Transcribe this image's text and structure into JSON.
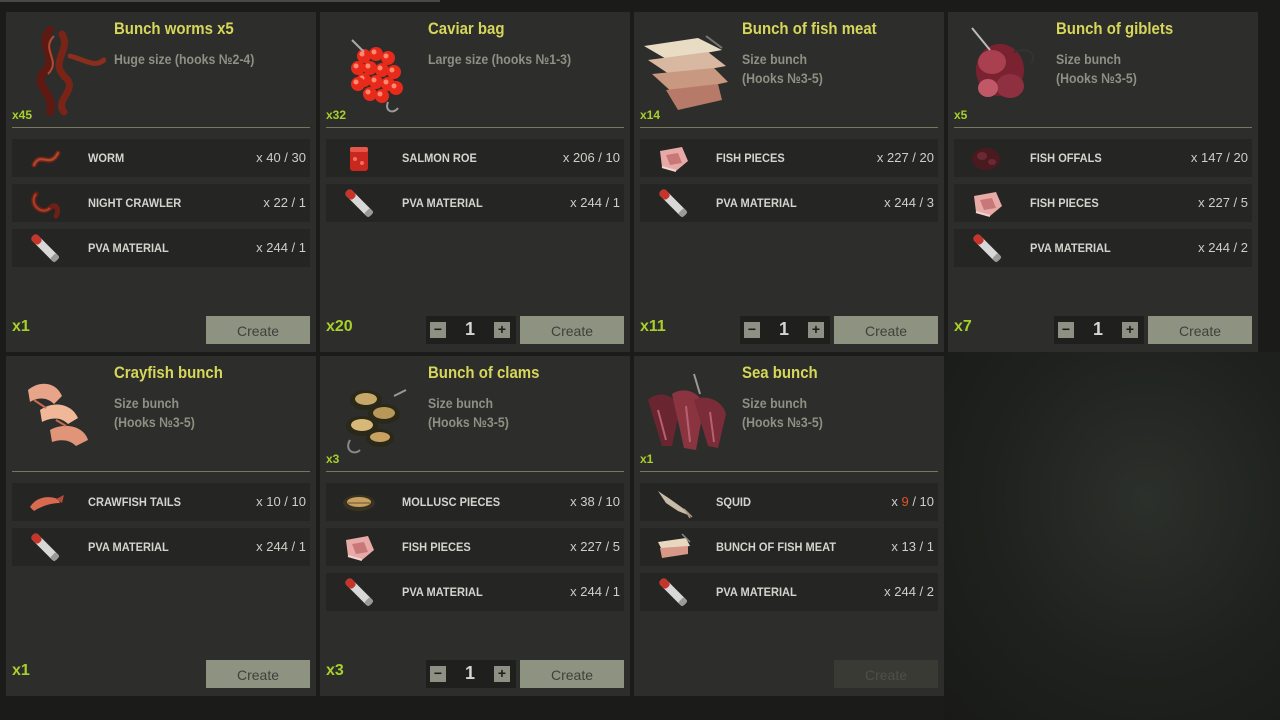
{
  "recipes": [
    {
      "title": "Bunch worms x5",
      "subtitle": "Huge size (hooks №2-4)",
      "stock": "x45",
      "multiplier": "x1",
      "stepper": null,
      "create_label": "Create",
      "create_enabled": true,
      "thumb_icon": "worm-bunch-icon",
      "ingredients": [
        {
          "icon": "worm-icon",
          "name": "WORM",
          "count": "x 40 / 30"
        },
        {
          "icon": "night-crawler-icon",
          "name": "NIGHT CRAWLER",
          "count": "x 22 / 1"
        },
        {
          "icon": "pva-material-icon",
          "name": "PVA MATERIAL",
          "count": "x 244 / 1"
        }
      ]
    },
    {
      "title": "Caviar bag",
      "subtitle": "Large size (hooks №1-3)",
      "stock": "x32",
      "multiplier": "x20",
      "stepper": "1",
      "create_label": "Create",
      "create_enabled": true,
      "thumb_icon": "caviar-bag-icon",
      "ingredients": [
        {
          "icon": "salmon-roe-icon",
          "name": "SALMON ROE",
          "count": "x 206 / 10"
        },
        {
          "icon": "pva-material-icon",
          "name": "PVA MATERIAL",
          "count": "x 244 / 1"
        }
      ]
    },
    {
      "title": "Bunch of fish meat",
      "subtitle": "Size bunch\n(Hooks №3-5)",
      "stock": "x14",
      "multiplier": "x11",
      "stepper": "1",
      "create_label": "Create",
      "create_enabled": true,
      "thumb_icon": "fish-meat-bunch-icon",
      "ingredients": [
        {
          "icon": "fish-pieces-icon",
          "name": "FISH PIECES",
          "count": "x 227 / 20"
        },
        {
          "icon": "pva-material-icon",
          "name": "PVA MATERIAL",
          "count": "x 244 / 3"
        }
      ]
    },
    {
      "title": "Bunch of giblets",
      "subtitle": "Size bunch\n(Hooks №3-5)",
      "stock": "x5",
      "multiplier": "x7",
      "stepper": "1",
      "create_label": "Create",
      "create_enabled": true,
      "thumb_icon": "giblets-bunch-icon",
      "ingredients": [
        {
          "icon": "fish-offals-icon",
          "name": "FISH OFFALS",
          "count": "x 147 / 20"
        },
        {
          "icon": "fish-pieces-icon",
          "name": "FISH PIECES",
          "count": "x 227 / 5"
        },
        {
          "icon": "pva-material-icon",
          "name": "PVA MATERIAL",
          "count": "x 244 / 2"
        }
      ]
    },
    {
      "title": "Crayfish bunch",
      "subtitle": "Size bunch\n(Hooks №3-5)",
      "stock": "",
      "multiplier": "x1",
      "stepper": null,
      "create_label": "Create",
      "create_enabled": true,
      "thumb_icon": "crayfish-bunch-icon",
      "ingredients": [
        {
          "icon": "crawfish-tails-icon",
          "name": "CRAWFISH TAILS",
          "count": "x 10 / 10"
        },
        {
          "icon": "pva-material-icon",
          "name": "PVA MATERIAL",
          "count": "x 244 / 1"
        }
      ]
    },
    {
      "title": "Bunch of clams",
      "subtitle": "Size bunch\n(Hooks №3-5)",
      "stock": "x3",
      "multiplier": "x3",
      "stepper": "1",
      "create_label": "Create",
      "create_enabled": true,
      "thumb_icon": "clams-bunch-icon",
      "ingredients": [
        {
          "icon": "mollusc-pieces-icon",
          "name": "MOLLUSC PIECES",
          "count": "x 38 / 10"
        },
        {
          "icon": "fish-pieces-icon",
          "name": "FISH PIECES",
          "count": "x 227 / 5"
        },
        {
          "icon": "pva-material-icon",
          "name": "PVA MATERIAL",
          "count": "x 244 / 1"
        }
      ]
    },
    {
      "title": "Sea bunch",
      "subtitle": "Size bunch\n(Hooks №3-5)",
      "stock": "x1",
      "multiplier": "",
      "stepper": null,
      "create_label": "Create",
      "create_enabled": false,
      "thumb_icon": "sea-bunch-icon",
      "ingredients": [
        {
          "icon": "squid-icon",
          "name": "SQUID",
          "count_prefix": "x ",
          "count_have": "9",
          "count_need": " / 10",
          "insufficient": true
        },
        {
          "icon": "bunch-of-fish-meat-icon",
          "name": "BUNCH OF FISH MEAT",
          "count": "x 13 / 1"
        },
        {
          "icon": "pva-material-icon",
          "name": "PVA MATERIAL",
          "count": "x 244 / 2"
        }
      ]
    }
  ],
  "colors": {
    "accent_green": "#a8d02a",
    "title_yellow": "#d6d65a",
    "insufficient_red": "#e0542e",
    "card_bg": "#2d2d2b",
    "row_bg": "#252523"
  }
}
